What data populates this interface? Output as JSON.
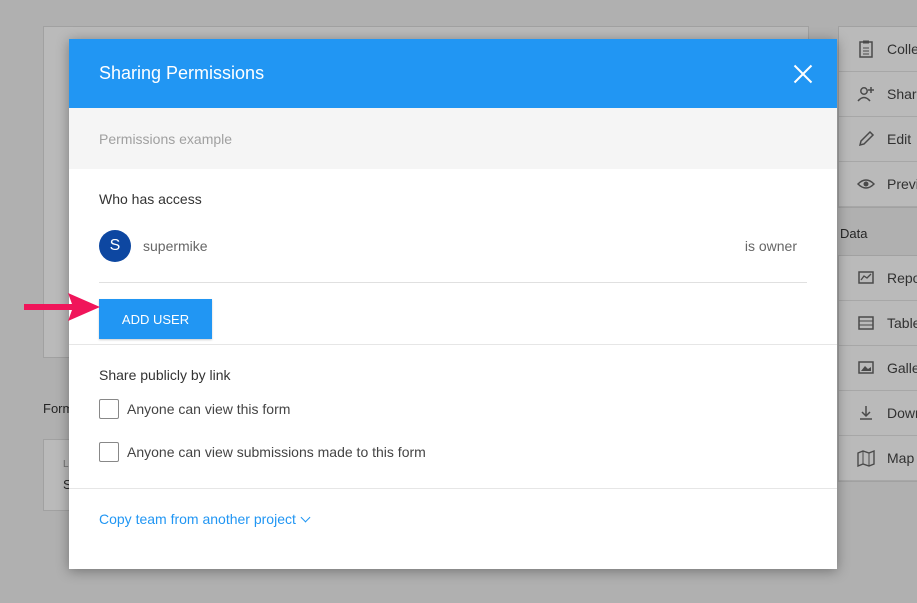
{
  "background": {
    "form_label": "Form",
    "card_line1": "L",
    "card_line2": "S",
    "sidebar_top": [
      {
        "icon": "clipboard-icon",
        "label": "Collect"
      },
      {
        "icon": "add-person-icon",
        "label": "Share"
      },
      {
        "icon": "pencil-icon",
        "label": "Edit"
      },
      {
        "icon": "eye-icon",
        "label": "Preview"
      }
    ],
    "data_title": "Data",
    "sidebar_data": [
      {
        "icon": "report-icon",
        "label": "Reports"
      },
      {
        "icon": "table-icon",
        "label": "Table"
      },
      {
        "icon": "gallery-icon",
        "label": "Gallery"
      },
      {
        "icon": "download-icon",
        "label": "Downloads"
      },
      {
        "icon": "map-icon",
        "label": "Map"
      }
    ]
  },
  "modal": {
    "title": "Sharing Permissions",
    "subtitle": "Permissions example",
    "access": {
      "title": "Who has access",
      "users": [
        {
          "initial": "S",
          "name": "supermike",
          "role": "is owner"
        }
      ],
      "add_user_label": "ADD USER"
    },
    "public": {
      "title": "Share publicly by link",
      "options": [
        {
          "label": "Anyone can view this form",
          "checked": false
        },
        {
          "label": "Anyone can view submissions made to this form",
          "checked": false
        }
      ]
    },
    "copy_team_label": "Copy team from another project"
  },
  "colors": {
    "primary": "#2196f3",
    "avatar": "#0d47a1",
    "annotation_arrow": "#f0155a"
  }
}
